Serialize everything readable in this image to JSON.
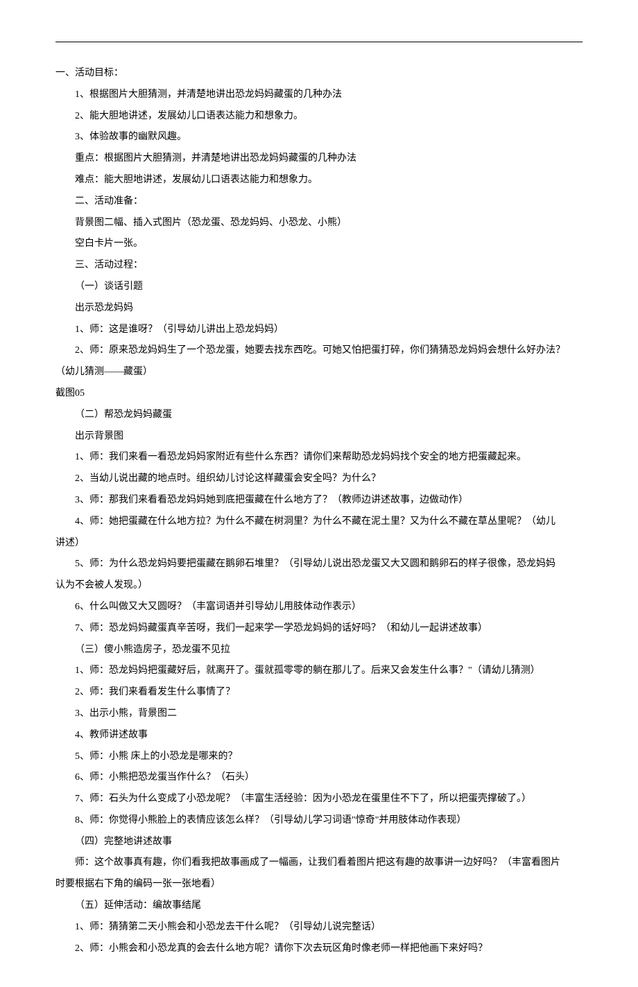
{
  "lines": [
    {
      "cls": "indent-0",
      "text": "一、活动目标："
    },
    {
      "cls": "indent-1",
      "text": "1、根据图片大胆猜测，并清楚地讲出恐龙妈妈藏蛋的几种办法"
    },
    {
      "cls": "indent-1",
      "text": "2、能大胆地讲述，发展幼儿口语表达能力和想象力。"
    },
    {
      "cls": "indent-1",
      "text": "3、体验故事的幽默风趣。"
    },
    {
      "cls": "indent-2",
      "text": "重点：根据图片大胆猜测，并清楚地讲出恐龙妈妈藏蛋的几种办法"
    },
    {
      "cls": "indent-1",
      "text": "难点：能大胆地讲述，发展幼儿口语表达能力和想象力。"
    },
    {
      "cls": "indent-1",
      "text": "二、活动准备："
    },
    {
      "cls": "indent-1",
      "text": "背景图二幅、插入式图片（恐龙蛋、恐龙妈妈、小恐龙、小熊）"
    },
    {
      "cls": "indent-1",
      "text": "空白卡片一张。"
    },
    {
      "cls": "indent-1",
      "text": "三、活动过程："
    },
    {
      "cls": "indent-1",
      "text": "（一）谈话引题"
    },
    {
      "cls": "indent-1",
      "text": "出示恐龙妈妈"
    },
    {
      "cls": "indent-1",
      "text": "1、师：这是谁呀？（引导幼儿讲出上恐龙妈妈）"
    },
    {
      "cls": "indent-wrap",
      "text": "2、师：原来恐龙妈妈生了一个恐龙蛋，她要去找东西吃。可她又怕把蛋打碎，你们猜猜恐龙妈妈会想什么好办法？"
    },
    {
      "cls": "no-indent",
      "text": "（幼儿猜测——藏蛋）"
    },
    {
      "cls": "no-indent",
      "text": "截图05"
    },
    {
      "cls": "indent-1",
      "text": "（二）帮恐龙妈妈藏蛋"
    },
    {
      "cls": "indent-1",
      "text": "出示背景图"
    },
    {
      "cls": "indent-1",
      "text": "1、师：我们来看一看恐龙妈妈家附近有些什么东西？请你们来帮助恐龙妈妈找个安全的地方把蛋藏起来。"
    },
    {
      "cls": "indent-1",
      "text": "2、当幼儿说出藏的地点时。组织幼儿讨论这样藏蛋会安全吗？为什么？"
    },
    {
      "cls": "indent-1",
      "text": "3、师：那我们来看看恐龙妈妈她到底把蛋藏在什么地方了？（教师边讲述故事，边做动作）"
    },
    {
      "cls": "indent-wrap",
      "text": "4、师：她把蛋藏在什么地方拉？为什么不藏在树洞里？为什么不藏在泥土里？又为什么不藏在草丛里呢？（幼儿"
    },
    {
      "cls": "no-indent",
      "text": "讲述）"
    },
    {
      "cls": "indent-wrap",
      "text": "5、师：为什么恐龙妈妈要把蛋藏在鹅卵石堆里？（引导幼儿说出恐龙蛋又大又圆和鹅卵石的样子很像，恐龙妈妈"
    },
    {
      "cls": "no-indent",
      "text": "认为不会被人发现。）"
    },
    {
      "cls": "indent-1",
      "text": "6、什么叫做又大又圆呀？（丰富词语并引导幼儿用肢体动作表示）"
    },
    {
      "cls": "indent-1",
      "text": "7、师：恐龙妈妈藏蛋真辛苦呀，我们一起来学一学恐龙妈妈的话好吗？（和幼儿一起讲述故事）"
    },
    {
      "cls": "indent-1",
      "text": "（三）傻小熊造房子，恐龙蛋不见拉"
    },
    {
      "cls": "indent-1",
      "text": "1、师：恐龙妈妈把蛋藏好后，就离开了。蛋就孤零零的躺在那儿了。后来又会发生什么事？\"（请幼儿猜测）"
    },
    {
      "cls": "indent-1",
      "text": "2、师：我们来看看发生什么事情了？"
    },
    {
      "cls": "indent-1",
      "text": "3、出示小熊，背景图二"
    },
    {
      "cls": "indent-1",
      "text": "4、教师讲述故事"
    },
    {
      "cls": "indent-1",
      "text": "5、师：小熊 床上的小恐龙是哪来的？"
    },
    {
      "cls": "indent-1",
      "text": "6、师：小熊把恐龙蛋当作什么？（石头）"
    },
    {
      "cls": "indent-1",
      "text": "7、师：石头为什么变成了小恐龙呢？（丰富生活经验：因为小恐龙在蛋里住不下了，所以把蛋壳撑破了。）"
    },
    {
      "cls": "indent-1",
      "text": "8、师：你觉得小熊脸上的表情应该怎么样？（引导幼儿学习词语\"惊奇\"并用肢体动作表现）"
    },
    {
      "cls": "indent-1",
      "text": "（四）完整地讲述故事"
    },
    {
      "cls": "indent-wrap",
      "text": "师：这个故事真有趣，你们看我把故事画成了一幅画，让我们看着图片把这有趣的故事讲一边好吗？（丰富看图片"
    },
    {
      "cls": "no-indent",
      "text": "时要根据右下角的编码一张一张地看）"
    },
    {
      "cls": "indent-1",
      "text": "（五）延伸活动：编故事结尾"
    },
    {
      "cls": "indent-1",
      "text": "1、师：猜猜第二天小熊会和小恐龙去干什么呢？（引导幼儿说完整话）"
    },
    {
      "cls": "indent-1",
      "text": "2、师：小熊会和小恐龙真的会去什么地方呢？请你下次去玩区角时像老师一样把他画下来好吗？"
    }
  ]
}
